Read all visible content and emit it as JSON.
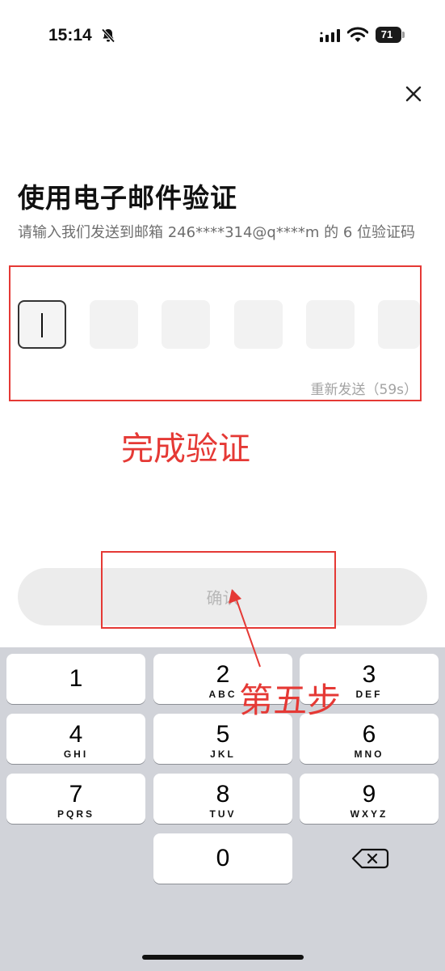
{
  "status": {
    "time": "15:14",
    "battery": "71"
  },
  "page": {
    "title": "使用电子邮件验证",
    "description": "请输入我们发送到邮箱 246****314@q****m 的 6 位验证码",
    "resend": "重新发送（59s）",
    "confirm_label": "确认"
  },
  "annotations": {
    "complete_verification": "完成验证",
    "step_five": "第五步",
    "color": "#e53935"
  },
  "keyboard": {
    "keys": [
      {
        "num": "1",
        "letters": ""
      },
      {
        "num": "2",
        "letters": "ABC"
      },
      {
        "num": "3",
        "letters": "DEF"
      },
      {
        "num": "4",
        "letters": "GHI"
      },
      {
        "num": "5",
        "letters": "JKL"
      },
      {
        "num": "6",
        "letters": "MNO"
      },
      {
        "num": "7",
        "letters": "PQRS"
      },
      {
        "num": "8",
        "letters": "TUV"
      },
      {
        "num": "9",
        "letters": "WXYZ"
      },
      {
        "num": "0",
        "letters": ""
      }
    ],
    "backspace_icon": "backspace-icon"
  },
  "icons": [
    "bell-slash-icon",
    "signal-icon",
    "wifi-icon",
    "battery-icon",
    "close-icon"
  ]
}
